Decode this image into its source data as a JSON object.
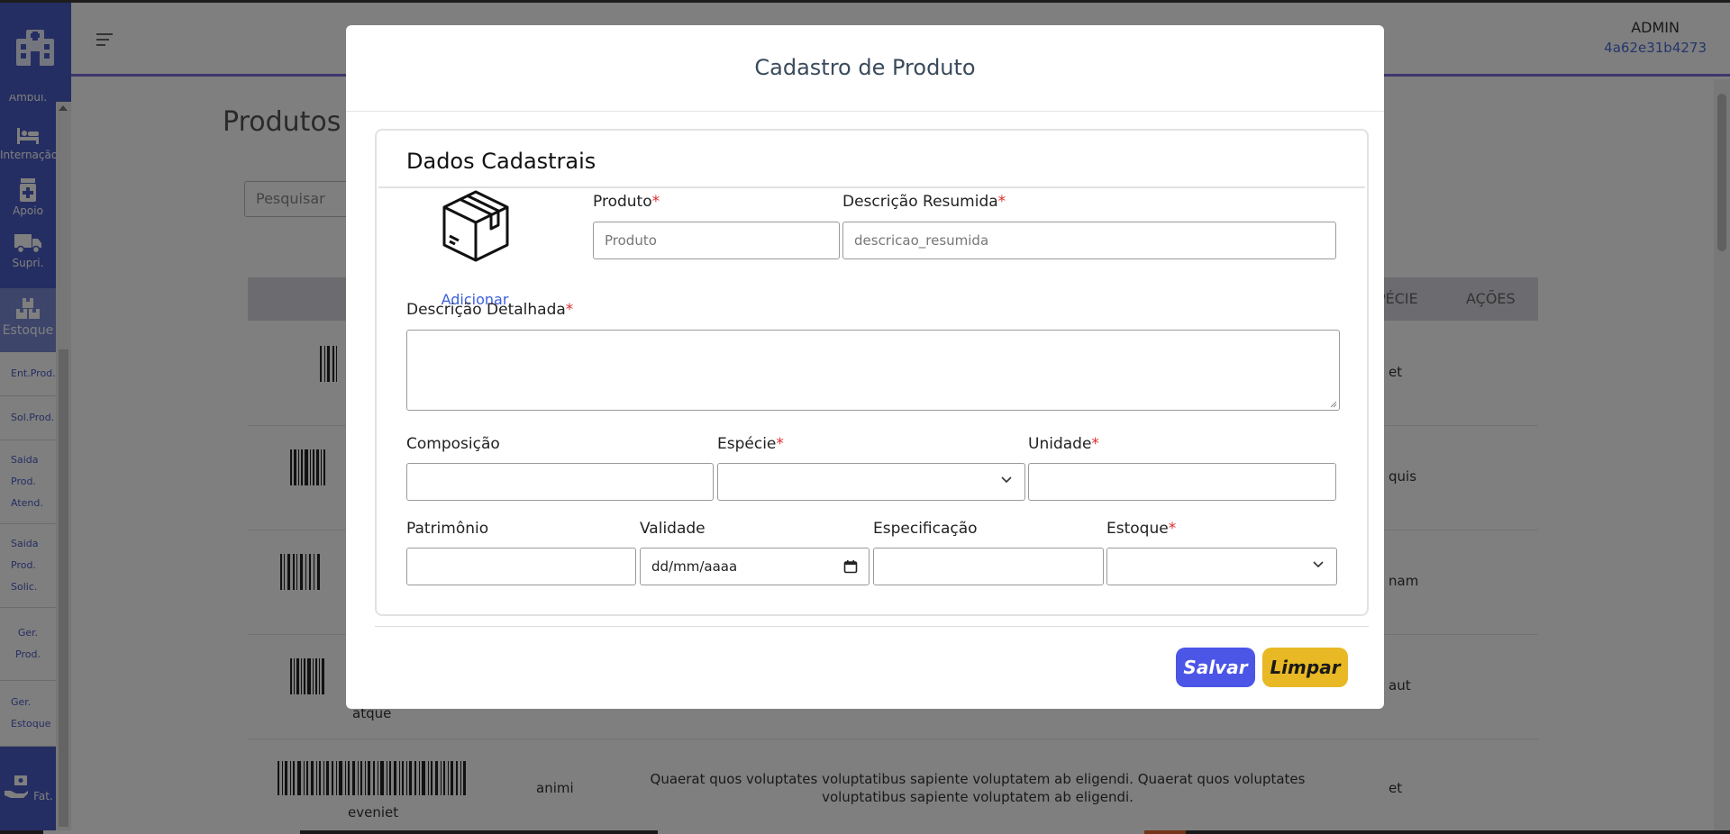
{
  "sidebar": {
    "modules": [
      {
        "label": "Ambul.",
        "icon": "ambulance-icon"
      },
      {
        "label": "Internação",
        "icon": "bed-icon"
      },
      {
        "label": "Apoio",
        "icon": "medicine-icon"
      },
      {
        "label": "Supri.",
        "icon": "truck-icon"
      },
      {
        "label": "Estoque",
        "icon": "boxes-icon"
      }
    ],
    "submenu": [
      "Ent.Prod.",
      "Sol.Prod.",
      "Saida Prod. Atend.",
      "Saida Prod. Solic.",
      "Ger. Prod.",
      "Ger. Estoque"
    ],
    "bottom": {
      "label": "Fat.",
      "icon": "hand-money-icon"
    }
  },
  "header": {
    "user_name": "ADMIN",
    "user_id": "4a62e31b4273"
  },
  "page": {
    "title": "Produtos",
    "search_placeholder": "Pesquisar",
    "columns_visible": [
      "PÉCIE",
      "AÇÕES"
    ],
    "rows": [
      {
        "species": "et"
      },
      {
        "species": "quis"
      },
      {
        "species": "nam"
      },
      {
        "code": "atque",
        "species": "aut"
      },
      {
        "code": "eveniet",
        "product": "animi",
        "description": "Quaerat quos voluptates voluptatibus sapiente voluptatem ab eligendi. Quaerat quos voluptates voluptatibus sapiente voluptatem ab eligendi.",
        "species": "et"
      }
    ]
  },
  "modal": {
    "title": "Cadastro de Produto",
    "section_title": "Dados Cadastrais",
    "image_add_label": "Adicionar",
    "required_mark": "*",
    "fields": {
      "produto": {
        "label": "Produto",
        "placeholder": "Produto"
      },
      "descricao_resumida": {
        "label": "Descrição Resumida",
        "placeholder": "descricao_resumida"
      },
      "descricao_detalhada": {
        "label": "Descrição Detalhada"
      },
      "composicao": {
        "label": "Composição"
      },
      "especie": {
        "label": "Espécie"
      },
      "unidade": {
        "label": "Unidade"
      },
      "patrimonio": {
        "label": "Patrimônio"
      },
      "validade": {
        "label": "Validade",
        "value": "dd/mm/aaaa"
      },
      "especificacao": {
        "label": "Especificação"
      },
      "estoque": {
        "label": "Estoque"
      }
    },
    "buttons": {
      "save": "Salvar",
      "clear": "Limpar"
    }
  }
}
